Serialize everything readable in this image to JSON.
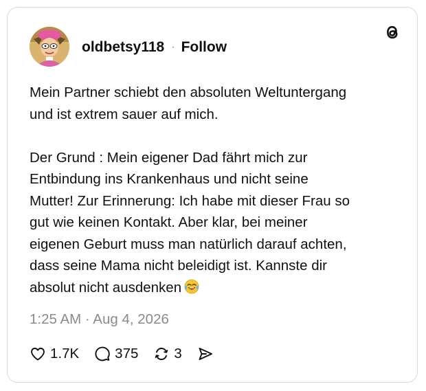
{
  "post": {
    "username": "oldbetsy118",
    "separator": "·",
    "follow_label": "Follow",
    "text_main": "Mein Partner schiebt den absoluten Weltuntergang\nund ist extrem sauer auf mich.\n\nDer Grund : Mein eigener Dad fährt mich zur\nEntbindung ins Krankenhaus und nicht seine\nMutter! Zur Erinnerung: Ich habe mit dieser Frau so\ngut wie keinen Kontakt. Aber klar, bei meiner\neigenen Geburt muss man natürlich darauf achten,\ndass seine Mama nicht beleidigt ist. Kannste dir\nabsolut nicht ausdenken",
    "emoji": "face-with-tears-of-joy",
    "timestamp": "1:25 AM · Aug 4, 2026"
  },
  "stats": {
    "likes": "1.7K",
    "replies": "375",
    "reposts": "3"
  },
  "icons": {
    "logo": "threads-logo-icon",
    "like": "heart-icon",
    "reply": "comment-icon",
    "repost": "repost-icon",
    "share": "send-icon"
  },
  "colors": {
    "text": "#101010",
    "muted": "#8a8a8a",
    "border": "#d9d9d9"
  }
}
